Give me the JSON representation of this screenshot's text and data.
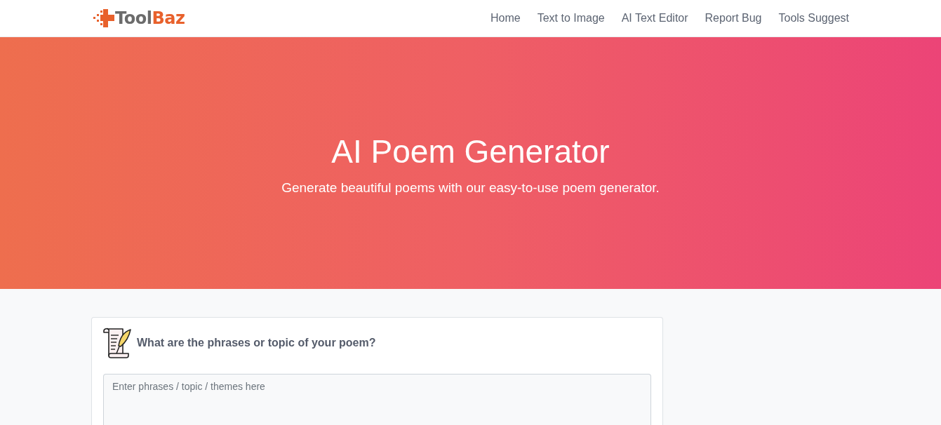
{
  "header": {
    "logo": {
      "parts": [
        {
          "text": "Tool",
          "color": "#6b6b6b"
        },
        {
          "text": "Baz",
          "color": "#e8612c"
        }
      ]
    },
    "nav": [
      "Home",
      "Text to Image",
      "AI Text Editor",
      "Report Bug",
      "Tools Suggest"
    ]
  },
  "hero": {
    "title": "AI Poem Generator",
    "subtitle": "Generate beautiful poems with our easy-to-use poem generator."
  },
  "form": {
    "question": "What are the phrases or topic of your poem?",
    "topic_field": {
      "placeholder": "Enter phrases / topic / themes here"
    }
  }
}
